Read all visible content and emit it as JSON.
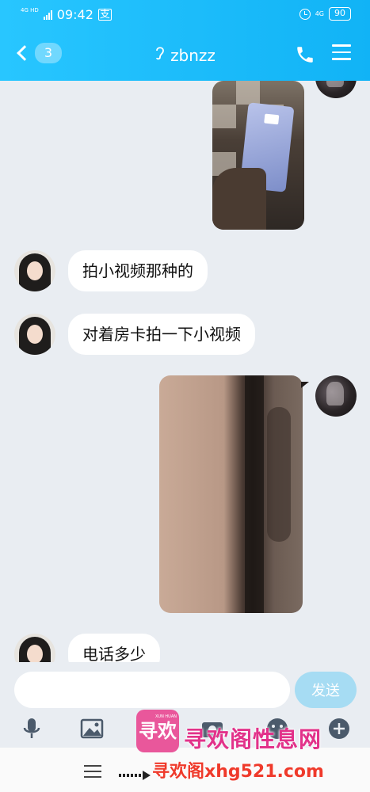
{
  "status_bar": {
    "network_type": "4G HD",
    "time": "09:42",
    "app_icon_glyph": "支",
    "battery": "90"
  },
  "header": {
    "back_badge": "3",
    "contact_name": "zbnzz",
    "icons": [
      "back-chevron-icon",
      "ear-icon",
      "phone-icon",
      "menu-icon"
    ]
  },
  "messages": [
    {
      "sender": "me",
      "type": "image",
      "description_icon": "image-thumbnail"
    },
    {
      "sender": "other",
      "type": "text",
      "text": "拍小视频那种的"
    },
    {
      "sender": "other",
      "type": "text",
      "text": "对着房卡拍一下小视频"
    },
    {
      "sender": "me",
      "type": "video"
    },
    {
      "sender": "other",
      "type": "text",
      "text": "电话多少"
    }
  ],
  "input": {
    "value": "",
    "placeholder": "",
    "send_label": "发送"
  },
  "toolbar_icons": [
    "microphone-icon",
    "image-icon",
    "camera-icon",
    "emoji-icon",
    "plus-icon"
  ],
  "watermark": {
    "logo_text": "寻欢",
    "logo_small": "XUN HUAN",
    "title": "寻欢阁性息网",
    "url": "寻欢阁xhg521.com"
  },
  "colors": {
    "header_start": "#28c6ff",
    "header_end": "#11b3f6",
    "chat_bg": "#e9edf2",
    "send_button": "#a6dcf3"
  }
}
